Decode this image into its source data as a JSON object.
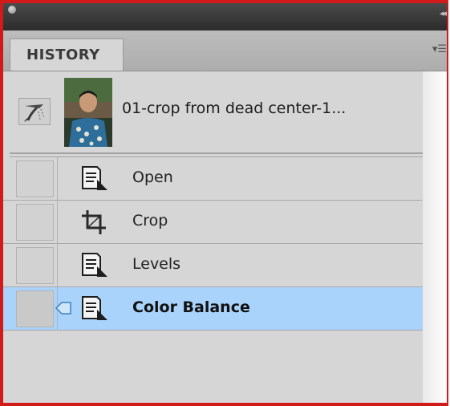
{
  "panel": {
    "tab_label": "HISTORY"
  },
  "snapshot": {
    "name": "01-crop from dead center-1..."
  },
  "history": {
    "items": [
      {
        "label": "Open",
        "icon": "document-icon",
        "selected": false
      },
      {
        "label": "Crop",
        "icon": "crop-icon",
        "selected": false
      },
      {
        "label": "Levels",
        "icon": "document-icon",
        "selected": false
      },
      {
        "label": "Color Balance",
        "icon": "document-icon",
        "selected": true
      }
    ]
  },
  "colors": {
    "frame_border": "#d31a1a",
    "selected_row": "#a9d3fb",
    "panel_bg": "#d6d6d6"
  }
}
